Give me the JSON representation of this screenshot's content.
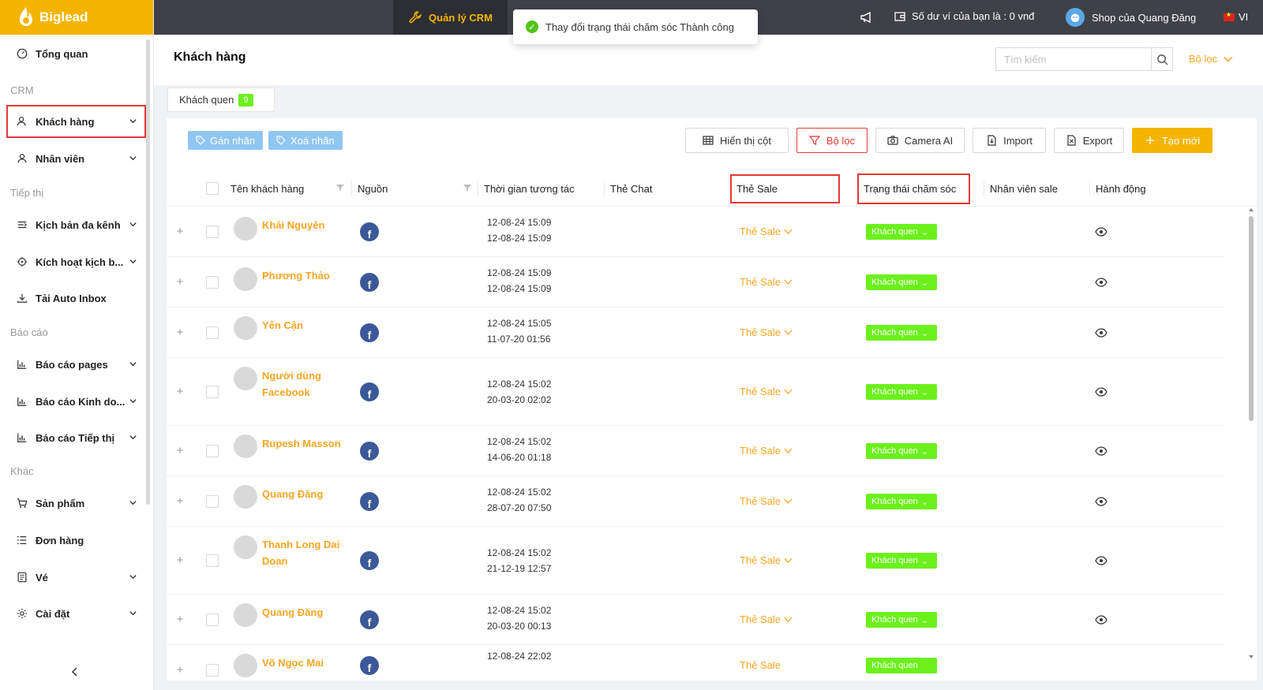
{
  "brand": {
    "name": "Biglead"
  },
  "topbar": {
    "crm_tab": "Quản lý CRM",
    "wallet_text": "Số dư ví của bạn là :  0 vnđ",
    "shop_name": "Shop của Quang Đăng",
    "language": "VI"
  },
  "toast": {
    "message": "Thay đổi trạng thái chăm sóc Thành công"
  },
  "sidebar": {
    "overview": "Tổng quan",
    "section_crm": "CRM",
    "customers": "Khách hàng",
    "staff": "Nhân viên",
    "section_marketing": "Tiếp thị",
    "multichannel_script": "Kịch bản đa kênh",
    "activate_script": "Kích hoạt kịch b...",
    "auto_inbox": "Tải Auto Inbox",
    "section_reports": "Báo cáo",
    "report_pages": "Báo cáo pages",
    "report_business": "Báo cáo Kinh do...",
    "report_marketing": "Báo cáo Tiếp thị",
    "section_other": "Khác",
    "products": "Sản phẩm",
    "orders": "Đơn hàng",
    "tickets": "Vé",
    "settings": "Cài đặt"
  },
  "header": {
    "title": "Khách hàng",
    "search_placeholder": "Tìm kiếm",
    "filter_link": "Bộ lọc"
  },
  "tab": {
    "label": "Khách quen",
    "count": "9"
  },
  "toolbar": {
    "assign_label": "Gán nhãn",
    "remove_label": "Xoá nhãn",
    "show_columns": "Hiển thị cột",
    "filter": "Bộ lọc",
    "camera_ai": "Camera AI",
    "import": "Import",
    "export": "Export",
    "create": "Tạo mới"
  },
  "table": {
    "columns": {
      "name": "Tên khách hàng",
      "source": "Nguồn",
      "interaction_time": "Thời gian tương tác",
      "chat_tag": "Thẻ Chat",
      "sale_tag": "Thẻ Sale",
      "care_status": "Trạng thái chăm sóc",
      "sales_staff": "Nhân viên sale",
      "action": "Hành động"
    },
    "rows": [
      {
        "name": "Khải Nguyên",
        "time1": "12-08-24 15:09",
        "time2": "12-08-24 15:09",
        "sale": "Thẻ Sale",
        "status": "Khách quen"
      },
      {
        "name": "Phương Thảo",
        "time1": "12-08-24 15:09",
        "time2": "12-08-24 15:09",
        "sale": "Thẻ Sale",
        "status": "Khách quen"
      },
      {
        "name": "Yến Cận",
        "time1": "12-08-24 15:05",
        "time2": "11-07-20 01:56",
        "sale": "Thẻ Sale",
        "status": "Khách quen"
      },
      {
        "name": "Người dùng Facebook",
        "time1": "12-08-24 15:02",
        "time2": "20-03-20 02:02",
        "sale": "Thẻ Sale",
        "status": "Khách quen"
      },
      {
        "name": "Rupesh Masson",
        "time1": "12-08-24 15:02",
        "time2": "14-06-20 01:18",
        "sale": "Thẻ Sale",
        "status": "Khách quen"
      },
      {
        "name": "Quang Đăng",
        "time1": "12-08-24 15:02",
        "time2": "28-07-20 07:50",
        "sale": "Thẻ Sale",
        "status": "Khách quen"
      },
      {
        "name": "Thanh Long Dai Doan",
        "time1": "12-08-24 15:02",
        "time2": "21-12-19 12:57",
        "sale": "Thẻ Sale",
        "status": "Khách quen"
      },
      {
        "name": "Quang Đăng",
        "time1": "12-08-24 15:02",
        "time2": "20-03-20 00:13",
        "sale": "Thẻ Sale",
        "status": "Khách quen"
      },
      {
        "name": "Võ Ngọc Mai",
        "time1": "12-08-24 22:02",
        "time2": "",
        "sale": "Thẻ Sale",
        "status": "Khách quen"
      }
    ]
  },
  "colors": {
    "brand": "#f5b400",
    "status_green": "#6cf01c",
    "highlight_red": "#e53935",
    "link_orange": "#f5a623",
    "facebook": "#3b5998"
  }
}
